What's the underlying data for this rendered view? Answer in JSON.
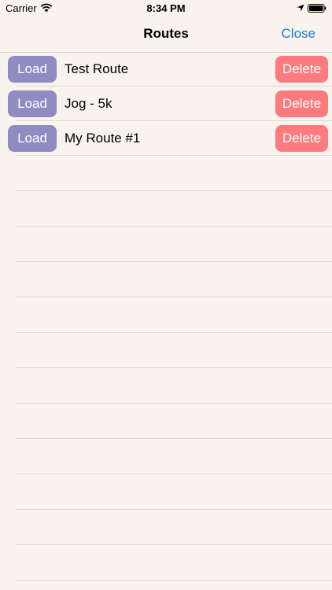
{
  "status_bar": {
    "carrier": "Carrier",
    "time": "8:34 PM",
    "icons": [
      "wifi-icon",
      "location-icon",
      "battery-icon"
    ]
  },
  "nav": {
    "title": "Routes",
    "close_label": "Close"
  },
  "routes": [
    {
      "name": "Test Route",
      "load_label": "Load",
      "delete_label": "Delete"
    },
    {
      "name": "Jog - 5k",
      "load_label": "Load",
      "delete_label": "Delete"
    },
    {
      "name": "My Route #1",
      "load_label": "Load",
      "delete_label": "Delete"
    }
  ],
  "colors": {
    "background": "#f8f3ec",
    "load_button": "#908bc2",
    "delete_button": "#fd7b7f",
    "link": "#1a7fd8",
    "separator": "#dcd9d3"
  }
}
